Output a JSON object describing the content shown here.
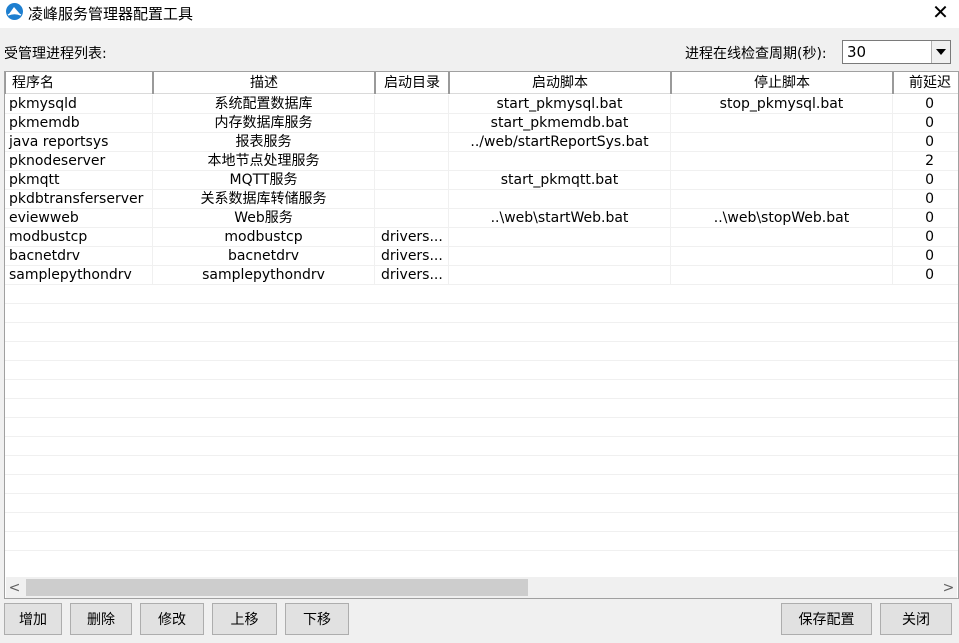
{
  "window": {
    "title": "凌峰服务管理器配置工具",
    "close_glyph": "✕"
  },
  "labels": {
    "process_list": "受管理进程列表:",
    "check_interval": "进程在线检查周期(秒):"
  },
  "interval_combo": {
    "value": "30"
  },
  "table": {
    "columns": [
      "程序名",
      "描述",
      "启动目录",
      "启动脚本",
      "停止脚本",
      "前延迟"
    ],
    "rows": [
      [
        "pkmysqld",
        "系统配置数据库",
        "",
        "start_pkmysql.bat",
        "stop_pkmysql.bat",
        "0"
      ],
      [
        "pkmemdb",
        "内存数据库服务",
        "",
        "start_pkmemdb.bat",
        "",
        "0"
      ],
      [
        "java reportsys",
        "报表服务",
        "",
        "../web/startReportSys.bat",
        "",
        "0"
      ],
      [
        "pknodeserver",
        "本地节点处理服务",
        "",
        "",
        "",
        "2"
      ],
      [
        "pkmqtt",
        "MQTT服务",
        "",
        "start_pkmqtt.bat",
        "",
        "0"
      ],
      [
        "pkdbtransferserver",
        "关系数据库转储服务",
        "",
        "",
        "",
        "0"
      ],
      [
        "eviewweb",
        "Web服务",
        "",
        "..\\web\\startWeb.bat",
        "..\\web\\stopWeb.bat",
        "0"
      ],
      [
        "modbustcp",
        "modbustcp",
        "drivers...",
        "",
        "",
        "0"
      ],
      [
        "bacnetdrv",
        "bacnetdrv",
        "drivers...",
        "",
        "",
        "0"
      ],
      [
        "samplepythondrv",
        "samplepythondrv",
        "drivers...",
        "",
        "",
        "0"
      ]
    ]
  },
  "scrollbar": {
    "left_arrow": "<",
    "right_arrow": ">"
  },
  "buttons": {
    "add": "增加",
    "delete": "删除",
    "modify": "修改",
    "move_up": "上移",
    "move_down": "下移",
    "save": "保存配置",
    "close": "关闭"
  }
}
